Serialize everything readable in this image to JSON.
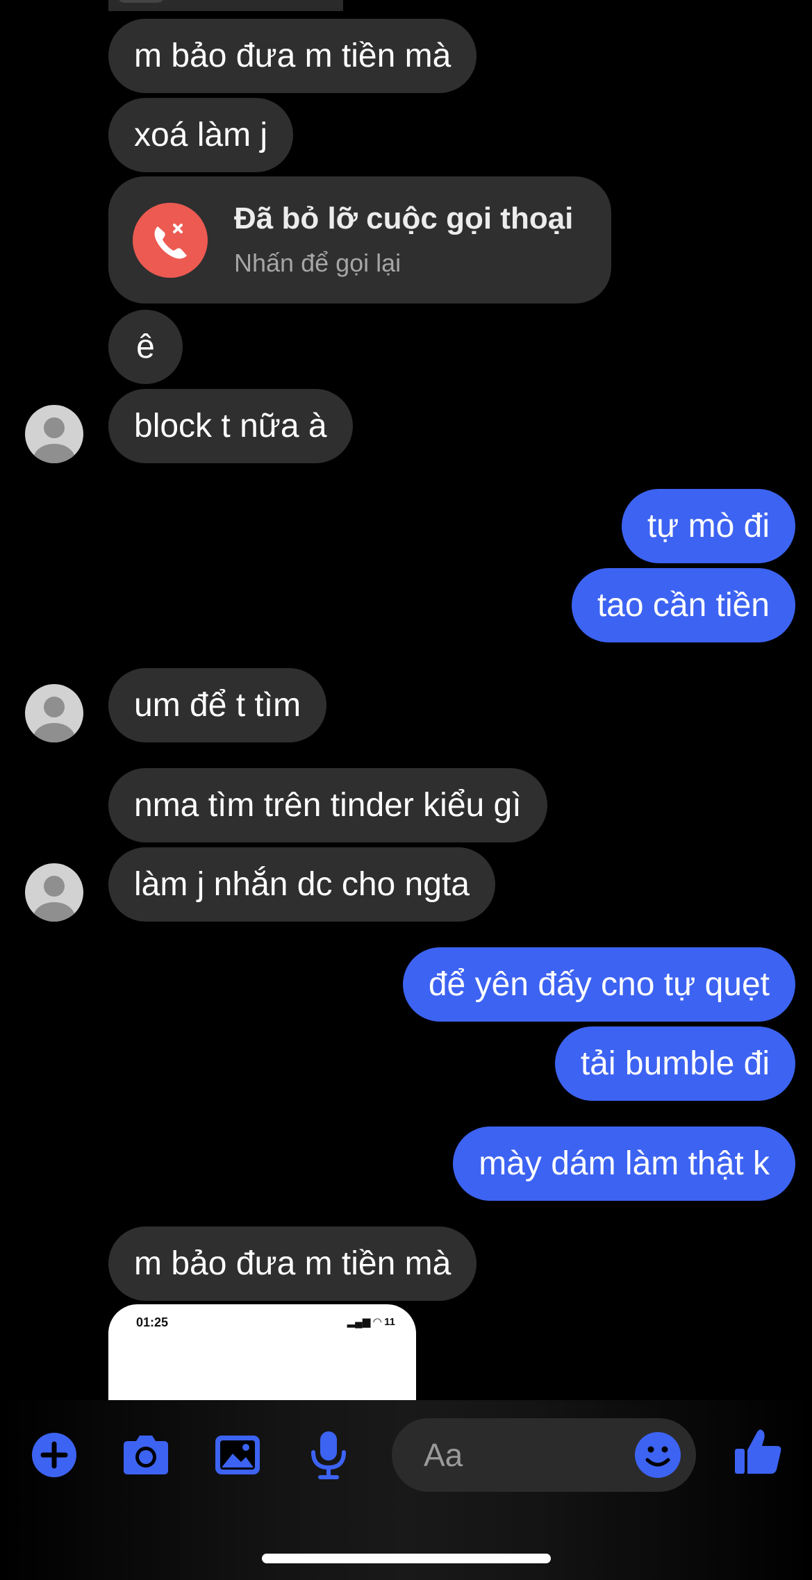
{
  "messages": [
    {
      "side": "in",
      "text": "m bảo đưa m tiền mà"
    },
    {
      "side": "in",
      "text": "xoá làm j"
    },
    {
      "side": "in",
      "text": "ê"
    },
    {
      "side": "in",
      "text": "block t nữa à"
    },
    {
      "side": "out",
      "text": "tự mò đi"
    },
    {
      "side": "out",
      "text": "tao cần tiền"
    },
    {
      "side": "in",
      "text": "um để t tìm"
    },
    {
      "side": "in",
      "text": "nma tìm trên tinder kiểu gì"
    },
    {
      "side": "in",
      "text": "làm j nhắn dc cho ngta"
    },
    {
      "side": "out",
      "text": "để yên đấy cno tự quẹt"
    },
    {
      "side": "out",
      "text": "tải bumble đi"
    },
    {
      "side": "out",
      "text": "mày dám làm thật k"
    },
    {
      "side": "in",
      "text": "m bảo đưa m tiền mà"
    }
  ],
  "missed_call": {
    "title": "Đã bỏ lỡ cuộc gọi thoại",
    "subtitle": "Nhấn để gọi lại",
    "icon": "missed-call-icon"
  },
  "shared_screenshot": {
    "time": "01:25",
    "battery": "11"
  },
  "composer": {
    "placeholder": "Aa",
    "buttons": [
      "plus-icon",
      "camera-icon",
      "gallery-icon",
      "microphone-icon",
      "emoji-icon",
      "like-icon"
    ]
  },
  "colors": {
    "background": "#000000",
    "incoming_bubble": "#2f2f2f",
    "outgoing_bubble": "#3d63f2",
    "accent": "#3d63f2",
    "missed_call": "#ec5a52"
  }
}
